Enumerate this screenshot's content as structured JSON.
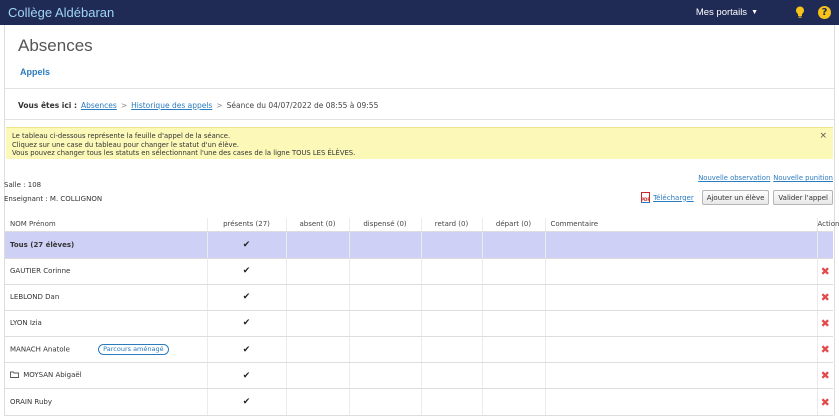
{
  "topbar": {
    "brand": "Collège Aldébaran",
    "portals": "Mes portails",
    "caret_icon": "caret-down-icon",
    "bulb_icon": "lightbulb-icon",
    "help_icon": "help-icon",
    "help_glyph": "?",
    "accent_color": "#f7c21a",
    "bar_color": "#1f2a55"
  },
  "page": {
    "title": "Absences",
    "subnav": "Appels"
  },
  "breadcrumb": {
    "label": "Vous êtes ici :",
    "crumbs": [
      "Absences",
      "Historique des appels"
    ],
    "separator": ">",
    "current": "Séance du 04/07/2022 de 08:55 à 09:55"
  },
  "notice": {
    "lines": [
      "Le tableau ci-dessous représente la feuille d'appel de la séance.",
      "Cliquez sur une case du tableau pour changer le statut d'un élève.",
      "Vous pouvez changer tous les statuts en sélectionnant l'une des cases de la ligne TOUS LES ÉLÈVES."
    ],
    "close": "×"
  },
  "info": {
    "salle": "Salle : 108",
    "enseignant": "Enseignant : M. COLLIGNON"
  },
  "links": {
    "observation": "Nouvelle observation",
    "punition": "Nouvelle punition"
  },
  "actions": {
    "download": "Télécharger",
    "add_student": "Ajouter un élève",
    "validate": "Valider l'appel"
  },
  "table": {
    "headers": [
      "NOM Prénom",
      "présents (27)",
      "absent (0)",
      "dispensé (0)",
      "retard (0)",
      "départ (0)",
      "Commentaire",
      "Action"
    ],
    "all_row": {
      "label": "Tous (27 élèves)",
      "present": "✔"
    },
    "rows": [
      {
        "name": "GAUTIER Corinne",
        "badge": "",
        "folder": false,
        "present": "✔",
        "action": "✖"
      },
      {
        "name": "LEBLOND Dan",
        "badge": "",
        "folder": false,
        "present": "✔",
        "action": "✖"
      },
      {
        "name": "LYON Izia",
        "badge": "",
        "folder": false,
        "present": "✔",
        "action": "✖"
      },
      {
        "name": "MANACH Anatole",
        "badge": "Parcours aménagé",
        "folder": false,
        "present": "✔",
        "action": "✖"
      },
      {
        "name": "MOYSAN Abigaël",
        "badge": "",
        "folder": true,
        "present": "✔",
        "action": "✖"
      },
      {
        "name": "ORAIN Ruby",
        "badge": "",
        "folder": false,
        "present": "✔",
        "action": "✖"
      }
    ]
  }
}
